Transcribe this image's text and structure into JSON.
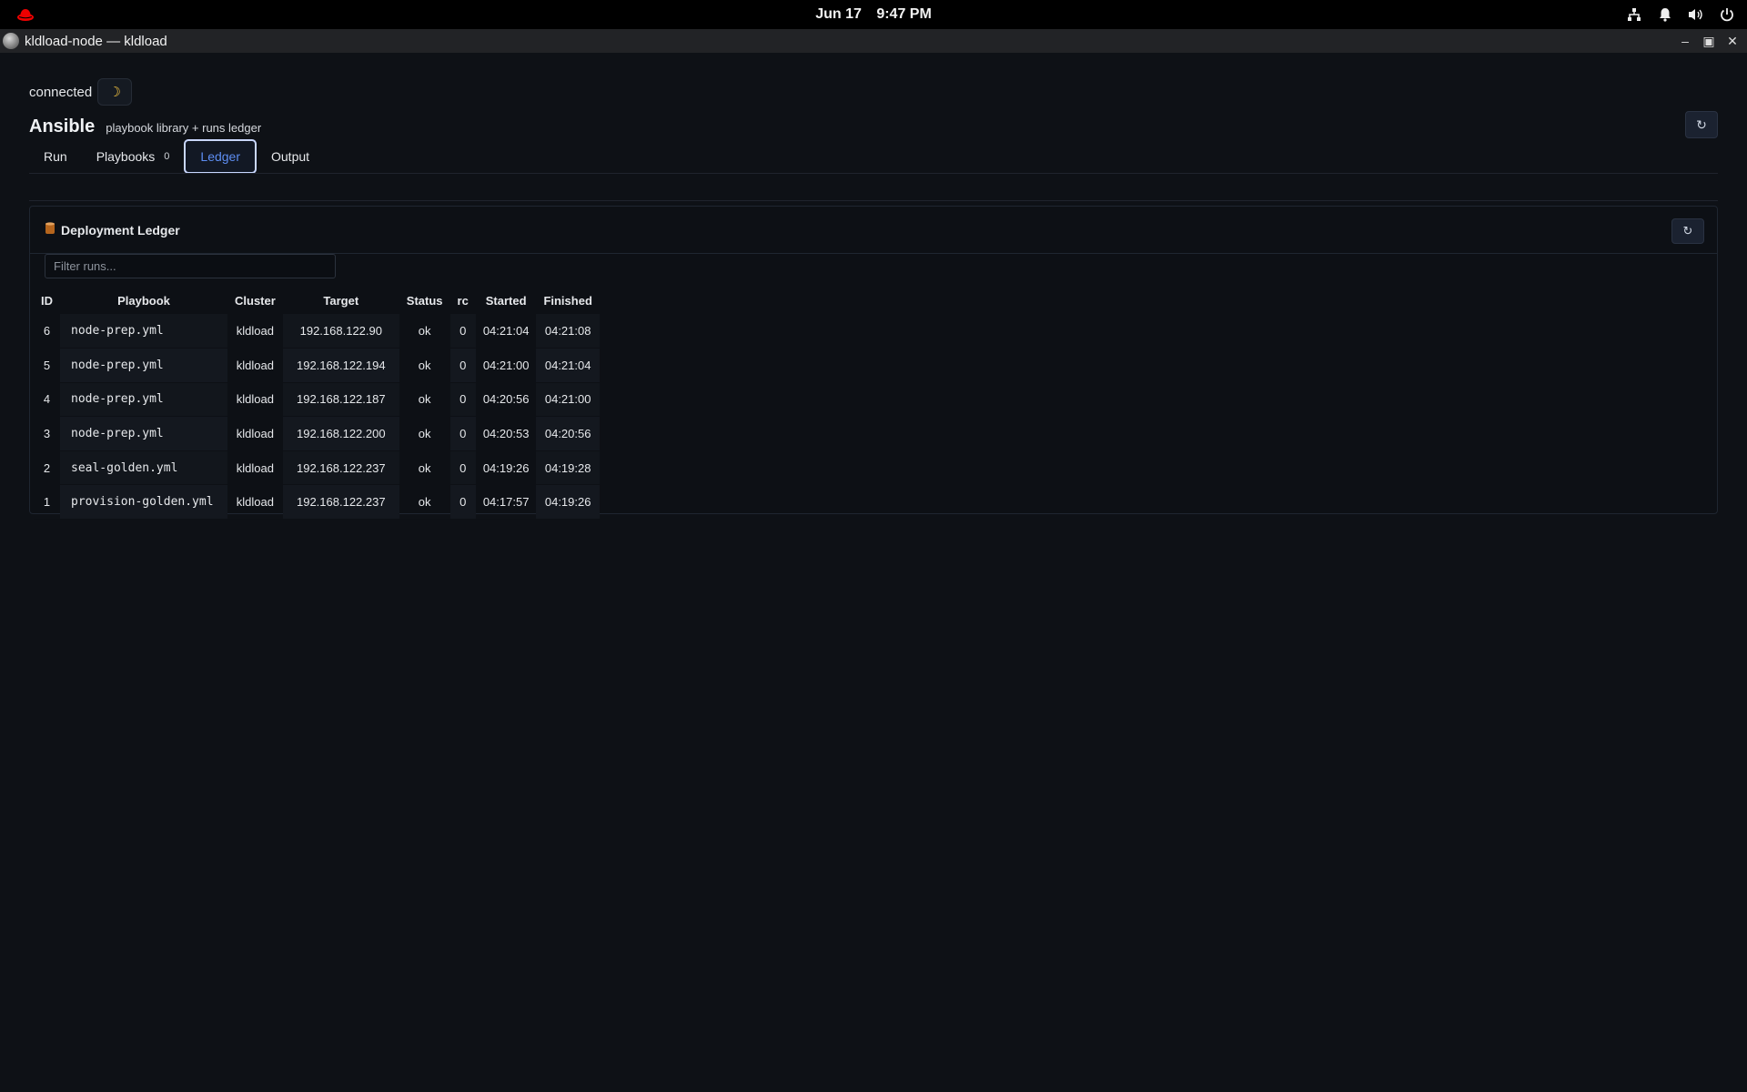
{
  "system": {
    "date": "Jun 17",
    "time": "9:47 PM"
  },
  "window": {
    "title": "kldload-node — kldload"
  },
  "connection": {
    "status": "connected",
    "theme_icon": "moon-icon"
  },
  "header": {
    "title": "Ansible",
    "subtitle": "playbook library + runs ledger"
  },
  "tabs": [
    {
      "label": "Run"
    },
    {
      "label": "Playbooks",
      "count": "0"
    },
    {
      "label": "Ledger"
    },
    {
      "label": "Output"
    }
  ],
  "ledger": {
    "title": "Deployment Ledger",
    "filter_placeholder": "Filter runs...",
    "columns": [
      "ID",
      "Playbook",
      "Cluster",
      "Target",
      "Status",
      "rc",
      "Started",
      "Finished"
    ],
    "rows": [
      {
        "id": "6",
        "playbook": "node-prep.yml",
        "cluster": "kldload",
        "target": "192.168.122.90",
        "status": "ok",
        "rc": "0",
        "started": "04:21:04",
        "finished": "04:21:08"
      },
      {
        "id": "5",
        "playbook": "node-prep.yml",
        "cluster": "kldload",
        "target": "192.168.122.194",
        "status": "ok",
        "rc": "0",
        "started": "04:21:00",
        "finished": "04:21:04"
      },
      {
        "id": "4",
        "playbook": "node-prep.yml",
        "cluster": "kldload",
        "target": "192.168.122.187",
        "status": "ok",
        "rc": "0",
        "started": "04:20:56",
        "finished": "04:21:00"
      },
      {
        "id": "3",
        "playbook": "node-prep.yml",
        "cluster": "kldload",
        "target": "192.168.122.200",
        "status": "ok",
        "rc": "0",
        "started": "04:20:53",
        "finished": "04:20:56"
      },
      {
        "id": "2",
        "playbook": "seal-golden.yml",
        "cluster": "kldload",
        "target": "192.168.122.237",
        "status": "ok",
        "rc": "0",
        "started": "04:19:26",
        "finished": "04:19:28"
      },
      {
        "id": "1",
        "playbook": "provision-golden.yml",
        "cluster": "kldload",
        "target": "192.168.122.237",
        "status": "ok",
        "rc": "0",
        "started": "04:17:57",
        "finished": "04:19:26"
      }
    ]
  },
  "colors": {
    "background": "#0e1116",
    "accent": "#5d8df2",
    "status_ok": "#4f7de8"
  }
}
